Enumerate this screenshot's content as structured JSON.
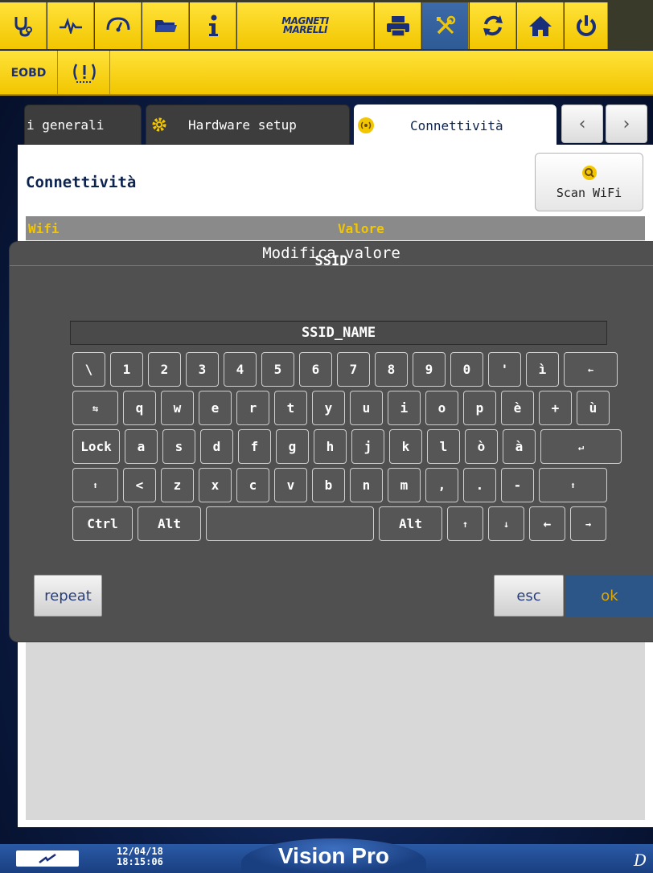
{
  "toolbar": {
    "brand": [
      "MAGNETI",
      "MARELLI"
    ],
    "icons": [
      "stethoscope-icon",
      "pulse-icon",
      "gauge-icon",
      "folder-icon",
      "info-icon",
      "printer-icon",
      "tools-icon",
      "refresh-icon",
      "home-icon",
      "power-icon"
    ]
  },
  "subbar": {
    "eobd_label": "EOBD"
  },
  "tabs": [
    {
      "label": "i generali"
    },
    {
      "label": "Hardware setup"
    },
    {
      "label": "Connettività"
    }
  ],
  "panel": {
    "title": "Connettività",
    "scan_label": "Scan WiFi",
    "table_headers": [
      "Wifi",
      "Valore"
    ]
  },
  "modal": {
    "title": "Modifica valore",
    "field_name": "SSID",
    "value": "SSID_NAME",
    "keyboard": {
      "row1": [
        "\\",
        "1",
        "2",
        "3",
        "4",
        "5",
        "6",
        "7",
        "8",
        "9",
        "0",
        "'",
        "ì",
        "←"
      ],
      "row2": [
        "⇆",
        "q",
        "w",
        "e",
        "r",
        "t",
        "y",
        "u",
        "i",
        "o",
        "p",
        "è",
        "+",
        "ù"
      ],
      "row3": [
        "Lock",
        "a",
        "s",
        "d",
        "f",
        "g",
        "h",
        "j",
        "k",
        "l",
        "ò",
        "à",
        "↵"
      ],
      "row4": [
        "⬆",
        "<",
        "z",
        "x",
        "c",
        "v",
        "b",
        "n",
        "m",
        ",",
        ".",
        "-",
        "⬆"
      ],
      "row5": [
        "Ctrl",
        "Alt",
        "",
        "Alt",
        "↑",
        "↓",
        "←",
        "→"
      ]
    },
    "repeat_label": "repeat",
    "esc_label": "esc",
    "ok_label": "ok"
  },
  "status": {
    "date": "12/04/18",
    "time": "18:15:06",
    "brand": "Vision Pro",
    "corner_glyph": "D"
  },
  "colors": {
    "toolbar_yellow": "#f2c600",
    "selected_blue": "#2e5b96",
    "modal_gray": "#505050",
    "accent_text": "#f2c600",
    "ok_blue": "#2c5588"
  }
}
